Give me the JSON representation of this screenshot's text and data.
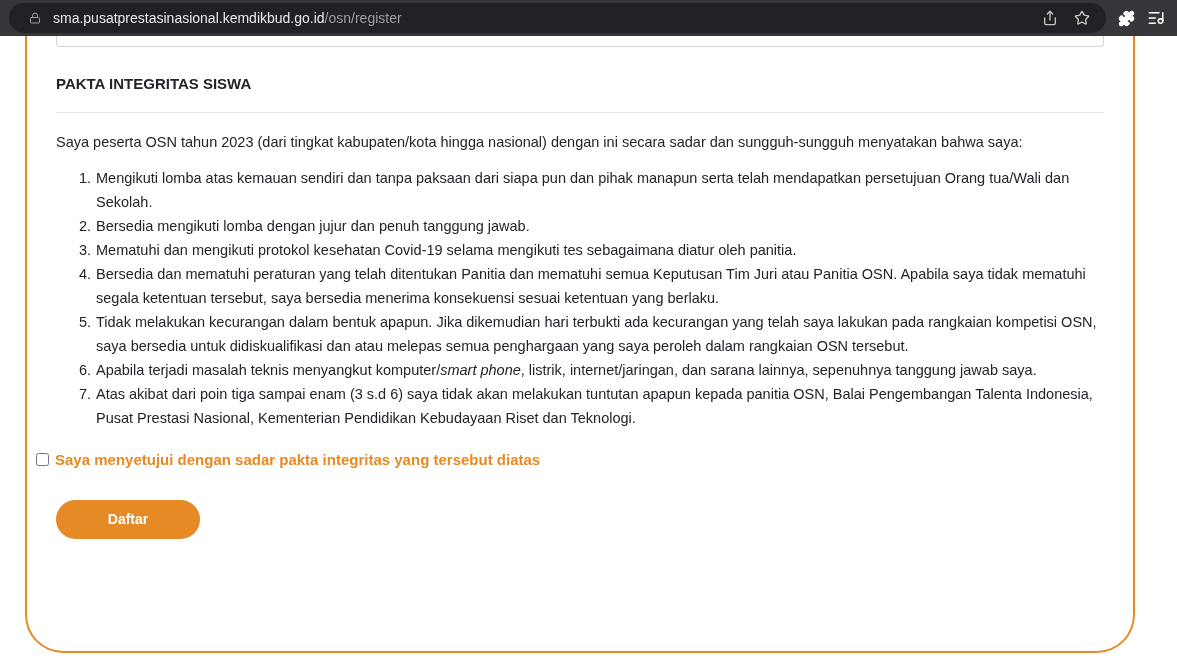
{
  "browser": {
    "url_host": "sma.pusatprestasinasional.kemdikbud.go.id",
    "url_path": "/osn/register"
  },
  "section": {
    "title": "PAKTA INTEGRITAS SISWA",
    "intro": "Saya peserta OSN tahun 2023 (dari tingkat kabupaten/kota hingga nasional) dengan ini secara sadar dan sungguh-sungguh menyatakan bahwa saya:",
    "items": [
      {
        "number": "1.",
        "text": "Mengikuti lomba atas kemauan sendiri dan tanpa paksaan dari siapa pun dan pihak manapun serta telah mendapatkan persetujuan Orang tua/Wali dan Sekolah."
      },
      {
        "number": "2.",
        "text": "Bersedia mengikuti lomba dengan jujur dan penuh tanggung jawab."
      },
      {
        "number": "3.",
        "text": "Mematuhi dan mengikuti protokol kesehatan Covid-19 selama mengikuti tes sebagaimana diatur oleh panitia."
      },
      {
        "number": "4.",
        "text": "Bersedia dan mematuhi peraturan yang telah ditentukan Panitia dan mematuhi semua Keputusan Tim Juri atau Panitia OSN. Apabila saya tidak mematuhi segala ketentuan tersebut, saya bersedia menerima konsekuensi sesuai ketentuan yang berlaku."
      },
      {
        "number": "5.",
        "text": "Tidak melakukan kecurangan dalam bentuk apapun. Jika dikemudian hari terbukti ada kecurangan yang telah saya lakukan pada rangkaian kompetisi OSN, saya bersedia untuk didiskualifikasi dan atau melepas semua penghargaan yang saya peroleh dalam rangkaian OSN tersebut."
      },
      {
        "number": "6.",
        "text": "Apabila terjadi masalah teknis menyangkut komputer/*smart phone*, listrik, internet/jaringan, dan sarana lainnya, sepenuhnya tanggung jawab saya."
      },
      {
        "number": "7.",
        "text": "Atas akibat dari poin tiga sampai enam (3 s.d 6) saya tidak akan melakukan tuntutan apapun kepada panitia OSN, Balai Pengembangan Talenta Indonesia, Pusat Prestasi Nasional, Kementerian Pendidikan Kebudayaan Riset dan Teknologi."
      }
    ]
  },
  "agreement": {
    "label": "Saya menyetujui dengan sadar pakta integritas yang tersebut diatas",
    "checked": false
  },
  "submit_button": "Daftar"
}
